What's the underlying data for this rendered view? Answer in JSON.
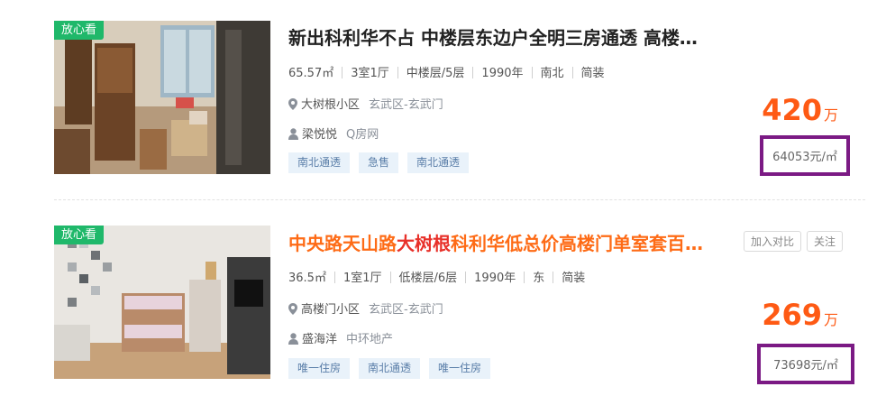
{
  "listings": [
    {
      "badge": "放心看",
      "title": "新出科利华不占 中楼层东边户全明三房通透 高楼…",
      "specs": [
        "65.57㎡",
        "3室1厅",
        "中楼层/5层",
        "1990年",
        "南北",
        "简装"
      ],
      "community": "大树根小区",
      "district": "玄武区-玄武门",
      "agent": "梁悦悦",
      "company": "Q房网",
      "tags": [
        "南北通透",
        "急售",
        "南北通透"
      ],
      "price": "420",
      "price_unit": "万",
      "unit_price": "64053元/㎡"
    },
    {
      "badge": "放心看",
      "title_pre": "中央路天山路",
      "title_hl": "大树根",
      "title_post": "科利华低总价高楼门单室套百…",
      "actions": [
        "加入对比",
        "关注"
      ],
      "specs": [
        "36.5㎡",
        "1室1厅",
        "低楼层/6层",
        "1990年",
        "东",
        "简装"
      ],
      "community": "高楼门小区",
      "district": "玄武区-玄武门",
      "agent": "盛海洋",
      "company": "中环地产",
      "tags": [
        "唯一住房",
        "南北通透",
        "唯一住房"
      ],
      "price": "269",
      "price_unit": "万",
      "unit_price": "73698元/㎡"
    }
  ],
  "colors": {
    "badge": "#1fb86a",
    "price": "#fe5a14",
    "highlight_box": "#7b1a84",
    "tag_bg": "#e9f2fa"
  },
  "icons": [
    "location-pin-icon",
    "person-icon"
  ]
}
